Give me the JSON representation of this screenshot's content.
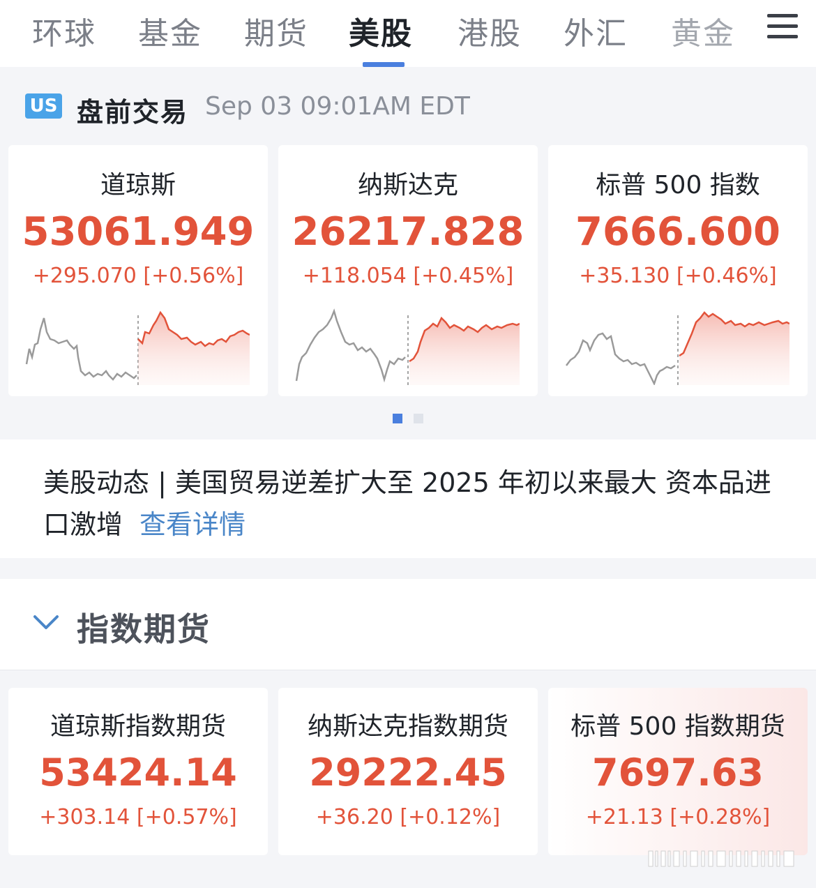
{
  "tabs": [
    {
      "label": "环球",
      "active": false
    },
    {
      "label": "基金",
      "active": false
    },
    {
      "label": "期货",
      "active": false
    },
    {
      "label": "美股",
      "active": true
    },
    {
      "label": "港股",
      "active": false
    },
    {
      "label": "外汇",
      "active": false
    },
    {
      "label": "黄金",
      "active": false
    }
  ],
  "menu_icon": "hamburger-menu-icon",
  "premarket": {
    "badge": "US",
    "title": "盘前交易",
    "time": "Sep 03 09:01AM EDT"
  },
  "indices": [
    {
      "name": "道琼斯",
      "value": "53061.949",
      "change": "+295.070 [+0.56%]"
    },
    {
      "name": "纳斯达克",
      "value": "26217.828",
      "change": "+118.054 [+0.45%]"
    },
    {
      "name": "标普 500 指数",
      "value": "7666.600",
      "change": "+35.130 [+0.46%]"
    }
  ],
  "pager": {
    "pages": 2,
    "active_index": 0
  },
  "news": {
    "text": "美股动态 | 美国贸易逆差扩大至 2025 年初以来最大 资本品进口激增",
    "link": "查看详情"
  },
  "futures": {
    "title": "指数期货",
    "items": [
      {
        "name": "道琼斯指数期货",
        "value": "53424.14",
        "change": "+303.14 [+0.57%]"
      },
      {
        "name": "纳斯达克指数期货",
        "value": "29222.45",
        "change": "+36.20 [+0.12%]"
      },
      {
        "name": "标普 500 指数期货",
        "value": "7697.63",
        "change": "+21.13 [+0.28%]"
      }
    ]
  },
  "colors": {
    "up": "#e2533a",
    "active_tab": "#4a7fde",
    "badge": "#4aa3e8",
    "link": "#4a86c8",
    "sparkline_prev": "#9a9a9a"
  }
}
